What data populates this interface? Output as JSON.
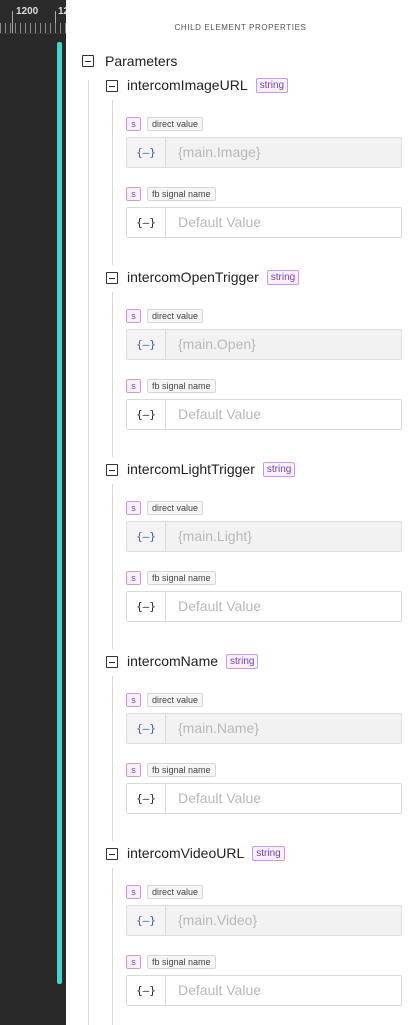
{
  "ruler": {
    "labels": [
      "1200",
      "12"
    ]
  },
  "panel": {
    "header": "CHILD ELEMENT PROPERTIES",
    "root_label": "Parameters",
    "groups": [
      {
        "name": "intercomImageURL",
        "type": "string",
        "direct": {
          "tag": "s",
          "label": "direct value",
          "icon": "{—}",
          "value": "{main.Image}"
        },
        "signal": {
          "tag": "s",
          "label": "fb signal name",
          "icon": "{—}",
          "placeholder": "Default Value"
        }
      },
      {
        "name": "intercomOpenTrigger",
        "type": "string",
        "direct": {
          "tag": "s",
          "label": "direct value",
          "icon": "{—}",
          "value": "{main.Open}"
        },
        "signal": {
          "tag": "s",
          "label": "fb signal name",
          "icon": "{—}",
          "placeholder": "Default Value"
        }
      },
      {
        "name": "intercomLightTrigger",
        "type": "string",
        "direct": {
          "tag": "s",
          "label": "direct value",
          "icon": "{—}",
          "value": "{main.Light}"
        },
        "signal": {
          "tag": "s",
          "label": "fb signal name",
          "icon": "{—}",
          "placeholder": "Default Value"
        }
      },
      {
        "name": "intercomName",
        "type": "string",
        "direct": {
          "tag": "s",
          "label": "direct value",
          "icon": "{—}",
          "value": "{main.Name}"
        },
        "signal": {
          "tag": "s",
          "label": "fb signal name",
          "icon": "{—}",
          "placeholder": "Default Value"
        }
      },
      {
        "name": "intercomVideoURL",
        "type": "string",
        "direct": {
          "tag": "s",
          "label": "direct value",
          "icon": "{—}",
          "value": "{main.Video}"
        },
        "signal": {
          "tag": "s",
          "label": "fb signal name",
          "icon": "{—}",
          "placeholder": "Default Value"
        }
      }
    ]
  },
  "colors": {
    "accent": "#28e0d6",
    "type_badge": "#7a3fb0",
    "bound_icon": "#3a5fd0"
  }
}
